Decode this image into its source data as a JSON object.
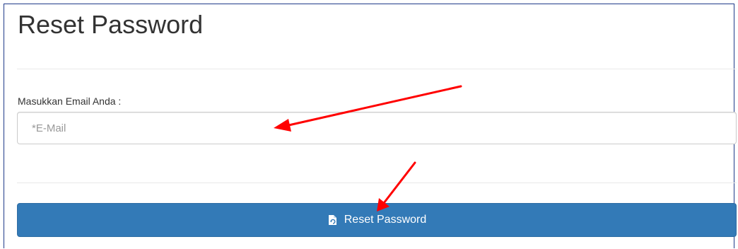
{
  "page": {
    "title": "Reset Password"
  },
  "form": {
    "email_label": "Masukkan Email Anda :",
    "email_placeholder": "*E-Mail",
    "email_value": ""
  },
  "actions": {
    "reset_label": "Reset Password",
    "reset_icon": "file-refresh-icon"
  },
  "annotations": {
    "arrow_color": "#ff0000",
    "arrows": [
      "arrow-to-email-field",
      "arrow-to-reset-button"
    ]
  },
  "colors": {
    "primary": "#337ab7",
    "border": "#cccccc",
    "text": "#333333"
  }
}
